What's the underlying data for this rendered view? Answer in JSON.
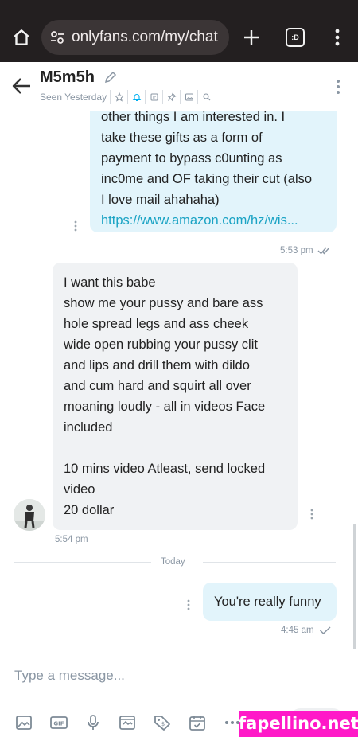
{
  "browser": {
    "url": "onlyfans.com/my/chat",
    "tab_count": ":D"
  },
  "chat": {
    "contact_name": "M5m5h",
    "seen_status": "Seen Yesterday"
  },
  "messages": [
    {
      "direction": "outgoing",
      "text": "other things I am interested in. I\ntake these gifts as a form of\npayment to bypass c0unting as\ninc0me and OF taking their cut (also\nI love mail ahahaha)",
      "link": "https://www.amazon.com/hz/wis...",
      "time": "5:53 pm"
    },
    {
      "direction": "incoming",
      "text": "I want this babe\nshow me your pussy and bare ass\nhole spread legs and ass cheek\nwide open rubbing your pussy clit\nand lips and drill them with dildo\nand cum hard and squirt all over\nmoaning loudly - all in videos Face\nincluded\n\n10 mins video Atleast, send locked\nvideo\n20 dollar",
      "time": "5:54 pm"
    },
    {
      "direction": "outgoing",
      "text": "You're really funny",
      "time": "4:45 am"
    }
  ],
  "day_divider": "Today",
  "composer": {
    "placeholder": "Type a message..."
  },
  "watermark": "fapellino.net",
  "colors": {
    "outgoing_bubble": "#e2f4fb",
    "incoming_bubble": "#f0f2f4",
    "link": "#1aa3c4",
    "watermark_bg": "#ff19c8"
  }
}
